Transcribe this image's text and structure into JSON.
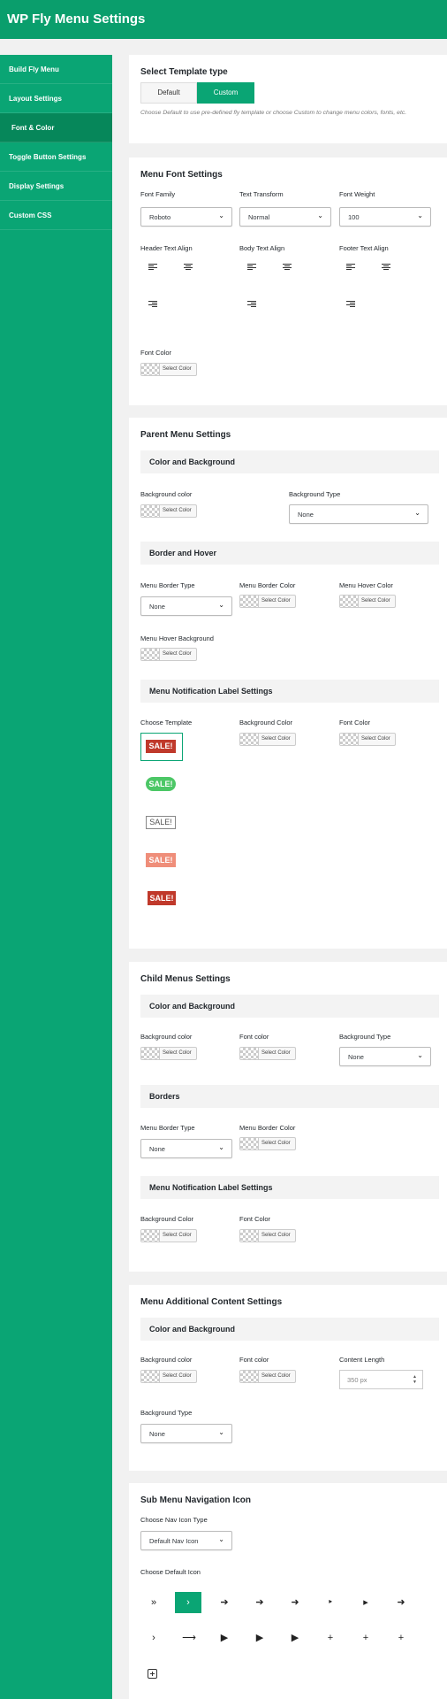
{
  "app_title": "WP Fly Menu Settings",
  "sidebar": {
    "items": [
      {
        "label": "Build Fly Menu"
      },
      {
        "label": "Layout Settings"
      },
      {
        "label": "Font & Color"
      },
      {
        "label": "Toggle Button Settings"
      },
      {
        "label": "Display Settings"
      },
      {
        "label": "Custom CSS"
      }
    ],
    "active_index": 2
  },
  "template": {
    "title": "Select Template type",
    "default_label": "Default",
    "custom_label": "Custom",
    "selected": "Custom",
    "help": "Choose Default to use pre-defined fly template or choose Custom to change menu colors, fonts, etc."
  },
  "font": {
    "title": "Menu Font Settings",
    "family_label": "Font Family",
    "family_value": "Roboto",
    "transform_label": "Text Transform",
    "transform_value": "Normal",
    "weight_label": "Font Weight",
    "weight_value": "100",
    "header_align_label": "Header Text Align",
    "body_align_label": "Body Text Align",
    "footer_align_label": "Footer Text Align",
    "color_label": "Font Color"
  },
  "select_color": "Select Color",
  "parent": {
    "title": "Parent Menu Settings",
    "cb_title": "Color and Background",
    "bg_color_label": "Background color",
    "bg_type_label": "Background Type",
    "bg_type_value": "None",
    "bh_title": "Border and Hover",
    "border_type_label": "Menu Border Type",
    "border_type_value": "None",
    "border_color_label": "Menu Border Color",
    "hover_color_label": "Menu Hover Color",
    "hover_bg_label": "Menu Hover Background",
    "notif_title": "Menu Notification Label Settings",
    "choose_template_label": "Choose Template",
    "notif_bg_label": "Background Color",
    "notif_font_label": "Font Color",
    "sale_text": "SALE!"
  },
  "child": {
    "title": "Child Menus Settings",
    "cb_title": "Color and Background",
    "bg_color_label": "Background color",
    "font_color_label": "Font color",
    "bg_type_label": "Background Type",
    "bg_type_value": "None",
    "borders_title": "Borders",
    "border_type_label": "Menu Border Type",
    "border_type_value": "None",
    "border_color_label": "Menu Border Color",
    "notif_title": "Menu Notification Label Settings",
    "notif_bg_label": "Background Color",
    "notif_font_label": "Font Color"
  },
  "additional": {
    "title": "Menu Additional Content Settings",
    "cb_title": "Color and Background",
    "bg_color_label": "Background color",
    "font_color_label": "Font color",
    "length_label": "Content Length",
    "length_value": "350 px",
    "bg_type_label": "Background Type",
    "bg_type_value": "None"
  },
  "subnav": {
    "title": "Sub Menu Navigation Icon",
    "type_label": "Choose Nav Icon Type",
    "type_value": "Default Nav Icon",
    "default_icon_label": "Choose Default Icon",
    "icons": [
      "»",
      "›",
      "➔",
      "➔",
      "➜",
      "‣",
      "▸",
      "➜",
      "›",
      "⟶",
      "▶",
      "▶",
      "▶",
      "+",
      "+",
      "+"
    ]
  },
  "colors": {
    "accent": "#0aa574",
    "header_bg": "#0a9e6c"
  }
}
